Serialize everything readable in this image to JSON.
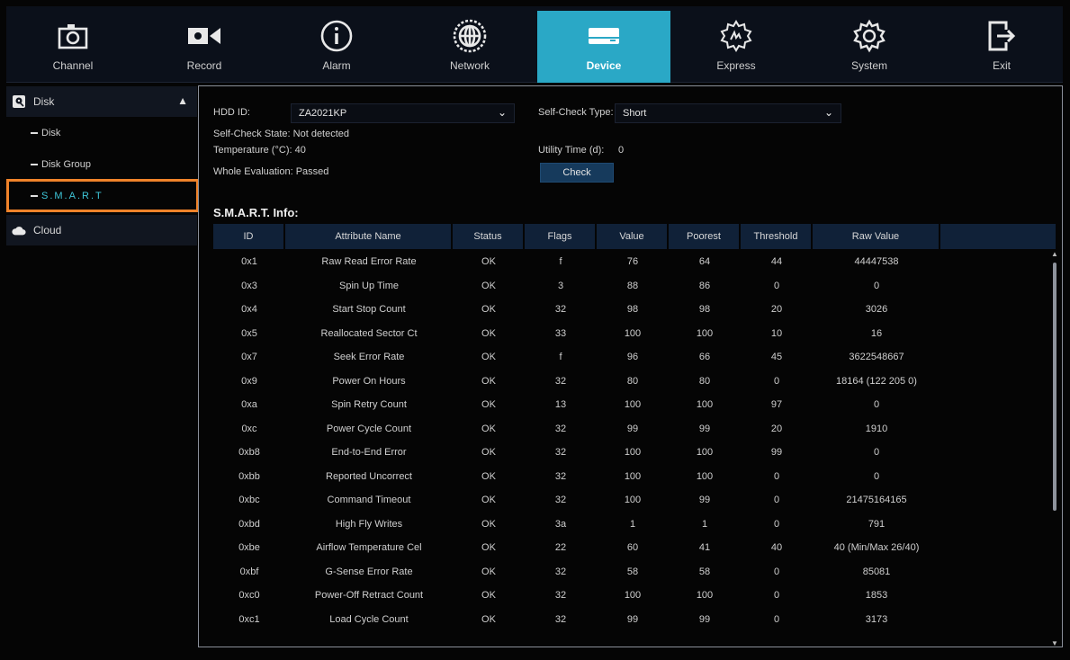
{
  "topnav": {
    "tabs": [
      {
        "label": "Channel",
        "icon": "camera-icon"
      },
      {
        "label": "Record",
        "icon": "video-camera-icon"
      },
      {
        "label": "Alarm",
        "icon": "info-circle-icon"
      },
      {
        "label": "Network",
        "icon": "globe-icon"
      },
      {
        "label": "Device",
        "icon": "hard-drive-icon",
        "active": true
      },
      {
        "label": "Express",
        "icon": "gear-hand-icon"
      },
      {
        "label": "System",
        "icon": "gear-icon"
      },
      {
        "label": "Exit",
        "icon": "exit-icon"
      }
    ],
    "accent_color": "#2aa8c6"
  },
  "sidebar": {
    "disk_group": {
      "label": "Disk",
      "icon": "disk-icon",
      "chevron": "chevron-up-icon"
    },
    "items": [
      {
        "label": "Disk"
      },
      {
        "label": "Disk Group"
      },
      {
        "label": "S.M.A.R.T",
        "active": true
      }
    ],
    "cloud_group": {
      "label": "Cloud",
      "icon": "cloud-icon"
    },
    "highlight_color": "#f0832a"
  },
  "main": {
    "hdd_id_label": "HDD ID:",
    "hdd_id_value": "ZA2021KP",
    "self_check_type_label": "Self-Check Type:",
    "self_check_type_value": "Short",
    "self_check_state": "Self-Check State: Not detected",
    "temperature": "Temperature (°C): 40",
    "utility_time_label": "Utility Time (d):",
    "utility_time_value": "0",
    "whole_evaluation": "Whole Evaluation: Passed",
    "check_button": "Check",
    "smart_title": "S.M.A.R.T. Info:"
  },
  "table": {
    "headers": [
      "ID",
      "Attribute Name",
      "Status",
      "Flags",
      "Value",
      "Poorest",
      "Threshold",
      "Raw Value"
    ],
    "rows": [
      [
        "0x1",
        "Raw Read Error Rate",
        "OK",
        "f",
        "76",
        "64",
        "44",
        "44447538"
      ],
      [
        "0x3",
        "Spin Up Time",
        "OK",
        "3",
        "88",
        "86",
        "0",
        "0"
      ],
      [
        "0x4",
        "Start Stop Count",
        "OK",
        "32",
        "98",
        "98",
        "20",
        "3026"
      ],
      [
        "0x5",
        "Reallocated Sector Ct",
        "OK",
        "33",
        "100",
        "100",
        "10",
        "16"
      ],
      [
        "0x7",
        "Seek Error Rate",
        "OK",
        "f",
        "96",
        "66",
        "45",
        "3622548667"
      ],
      [
        "0x9",
        "Power On Hours",
        "OK",
        "32",
        "80",
        "80",
        "0",
        "18164 (122 205 0)"
      ],
      [
        "0xa",
        "Spin Retry Count",
        "OK",
        "13",
        "100",
        "100",
        "97",
        "0"
      ],
      [
        "0xc",
        "Power Cycle Count",
        "OK",
        "32",
        "99",
        "99",
        "20",
        "1910"
      ],
      [
        "0xb8",
        "End-to-End Error",
        "OK",
        "32",
        "100",
        "100",
        "99",
        "0"
      ],
      [
        "0xbb",
        "Reported Uncorrect",
        "OK",
        "32",
        "100",
        "100",
        "0",
        "0"
      ],
      [
        "0xbc",
        "Command Timeout",
        "OK",
        "32",
        "100",
        "99",
        "0",
        "21475164165"
      ],
      [
        "0xbd",
        "High Fly Writes",
        "OK",
        "3a",
        "1",
        "1",
        "0",
        "791"
      ],
      [
        "0xbe",
        "Airflow Temperature Cel",
        "OK",
        "22",
        "60",
        "41",
        "40",
        "40 (Min/Max 26/40)"
      ],
      [
        "0xbf",
        "G-Sense Error Rate",
        "OK",
        "32",
        "58",
        "58",
        "0",
        "85081"
      ],
      [
        "0xc0",
        "Power-Off Retract Count",
        "OK",
        "32",
        "100",
        "100",
        "0",
        "1853"
      ],
      [
        "0xc1",
        "Load Cycle Count",
        "OK",
        "32",
        "99",
        "99",
        "0",
        "3173"
      ]
    ]
  }
}
